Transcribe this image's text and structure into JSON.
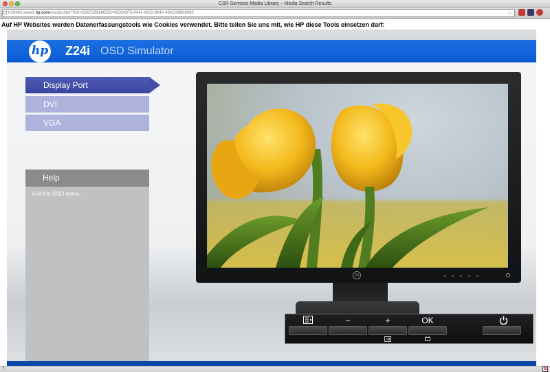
{
  "window": {
    "title": "CSR Services Media Library – Media Search Results"
  },
  "address": {
    "prefix": "h20464.www2.",
    "domain": "hp.com",
    "path": "/results.htm?SID=5367298&MEID=402042F5-9441-4202-8040-48AC68896062"
  },
  "cookie_notice": "Auf HP Websites werden Datenerfassungstools wie Cookies verwendet. Bitte teilen Sie uns mit, wie HP diese Tools einsetzen darf:",
  "header": {
    "logo": "hp",
    "model": "Z24i",
    "title": "OSD Simulator"
  },
  "menu": [
    {
      "label": "Display Port",
      "active": true
    },
    {
      "label": "DVI",
      "active": false
    },
    {
      "label": "VGA",
      "active": false
    }
  ],
  "help": {
    "title": "Help",
    "text": "Exit the OSD menu."
  },
  "monitor": {
    "logo": "hp"
  },
  "osd": {
    "minus": "−",
    "plus": "+",
    "ok": "OK"
  },
  "status": {
    "close": "×",
    "badge": "S"
  },
  "colors": {
    "brand_blue": "#0b5bd2",
    "menu_active": "#3a45a0",
    "menu_inactive": "#aeb3dd"
  }
}
